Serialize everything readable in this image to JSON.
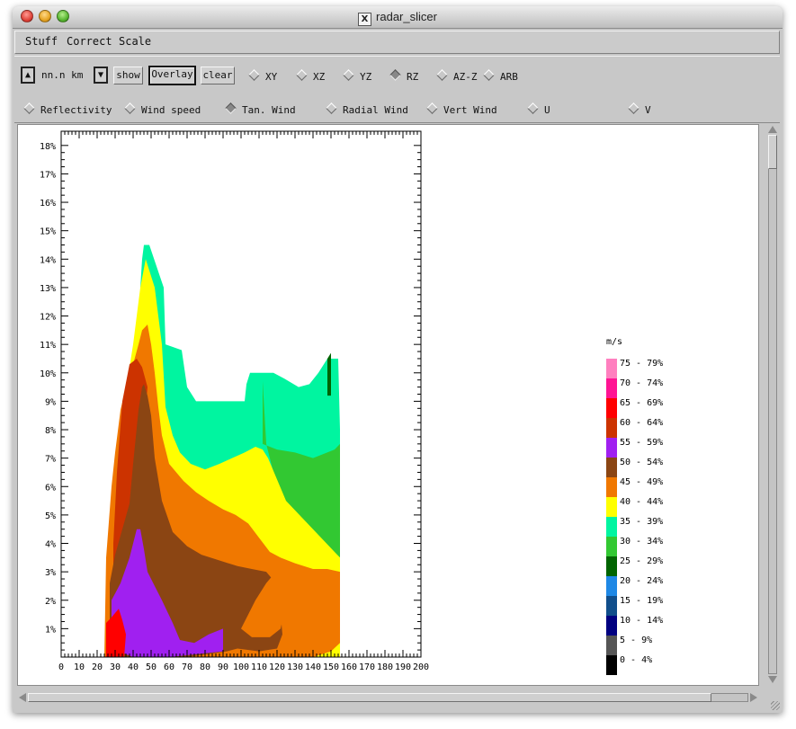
{
  "window": {
    "title": "radar_slicer"
  },
  "menubar": {
    "items": [
      "Stuff",
      "Correct",
      "Scale"
    ]
  },
  "toolbar": {
    "height_label": "nn.n km",
    "show_label": "show",
    "overlay_label": "Overlay",
    "clear_label": "clear",
    "views": [
      {
        "label": "XY",
        "selected": false
      },
      {
        "label": "XZ",
        "selected": false
      },
      {
        "label": "YZ",
        "selected": false
      },
      {
        "label": "RZ",
        "selected": true
      },
      {
        "label": "AZ-Z",
        "selected": false
      },
      {
        "label": "ARB",
        "selected": false
      }
    ],
    "fields": [
      {
        "label": "Reflectivity",
        "selected": false
      },
      {
        "label": "Wind speed",
        "selected": false
      },
      {
        "label": "Tan. Wind",
        "selected": true
      },
      {
        "label": "Radial Wind",
        "selected": false
      },
      {
        "label": "Vert Wind",
        "selected": false
      },
      {
        "label": "U",
        "selected": false
      },
      {
        "label": "V",
        "selected": false
      }
    ]
  },
  "chart_data": {
    "type": "heatmap",
    "title": "",
    "xlabel": "",
    "ylabel": "",
    "x_ticks": [
      "0",
      "10",
      "20",
      "30",
      "40",
      "50",
      "60",
      "70",
      "80",
      "90",
      "100",
      "110",
      "120",
      "130",
      "140",
      "150",
      "160",
      "170",
      "180",
      "190",
      "200"
    ],
    "y_ticks": [
      "1%",
      "2%",
      "3%",
      "4%",
      "5%",
      "6%",
      "7%",
      "8%",
      "9%",
      "10%",
      "11%",
      "12%",
      "13%",
      "14%",
      "15%",
      "16%",
      "17%",
      "18%"
    ],
    "xlim": [
      0,
      200
    ],
    "ylim": [
      0,
      18.5
    ],
    "grid": false,
    "legend": {
      "placement": "right",
      "unit": "m/s",
      "entries": [
        {
          "label": "75 - 79%",
          "color": "#ff7fbf"
        },
        {
          "label": "70 - 74%",
          "color": "#ff1493"
        },
        {
          "label": "65 - 69%",
          "color": "#ff0000"
        },
        {
          "label": "60 - 64%",
          "color": "#cc3300"
        },
        {
          "label": "55 - 59%",
          "color": "#a020f0"
        },
        {
          "label": "50 - 54%",
          "color": "#8b4513"
        },
        {
          "label": "45 - 49%",
          "color": "#f07800"
        },
        {
          "label": "40 - 44%",
          "color": "#ffff00"
        },
        {
          "label": "35 - 39%",
          "color": "#00f5a0"
        },
        {
          "label": "30 - 34%",
          "color": "#32c832"
        },
        {
          "label": "25 - 29%",
          "color": "#006400"
        },
        {
          "label": "20 - 24%",
          "color": "#1e88e5"
        },
        {
          "label": "15 - 19%",
          "color": "#104e8b"
        },
        {
          "label": "10 - 14%",
          "color": "#000080"
        },
        {
          "label": "5 - 9%",
          "color": "#555555"
        },
        {
          "label": "0 - 4%",
          "color": "#000000"
        }
      ]
    },
    "contour_bands": [
      {
        "color": "#00f5a0",
        "points": [
          [
            44,
            2
          ],
          [
            44,
            13
          ],
          [
            45,
            14
          ],
          [
            46,
            14.5
          ],
          [
            49,
            14.5
          ],
          [
            57,
            13
          ],
          [
            58,
            11
          ],
          [
            67,
            10.8
          ],
          [
            70,
            9.5
          ],
          [
            75,
            9
          ],
          [
            102,
            9
          ],
          [
            103,
            9.6
          ],
          [
            105,
            10
          ],
          [
            110,
            10
          ],
          [
            118,
            10
          ],
          [
            124,
            9.8
          ],
          [
            132,
            9.5
          ],
          [
            138,
            9.6
          ],
          [
            143,
            10
          ],
          [
            148,
            10.5
          ],
          [
            154,
            10.5
          ],
          [
            155,
            8
          ],
          [
            155,
            6
          ],
          [
            152,
            4
          ],
          [
            146,
            4.2
          ],
          [
            130,
            4.5
          ],
          [
            115,
            5
          ],
          [
            105,
            4.8
          ],
          [
            98,
            4
          ],
          [
            90,
            3.5
          ],
          [
            75,
            3.2
          ],
          [
            60,
            3
          ],
          [
            50,
            2.5
          ]
        ]
      },
      {
        "color": "#32c832",
        "points": [
          [
            112,
            9.7
          ],
          [
            112,
            7.5
          ],
          [
            120,
            7.3
          ],
          [
            130,
            7.2
          ],
          [
            140,
            7
          ],
          [
            152,
            7.3
          ],
          [
            155,
            7.5
          ],
          [
            155,
            3.5
          ],
          [
            150,
            3.8
          ],
          [
            140,
            4.5
          ],
          [
            128,
            5
          ],
          [
            120,
            6
          ],
          [
            114,
            7.5
          ]
        ]
      },
      {
        "color": "#ffff00",
        "points": [
          [
            36,
            0
          ],
          [
            33,
            5.5
          ],
          [
            33,
            8
          ],
          [
            36,
            9.5
          ],
          [
            38,
            10.2
          ],
          [
            40,
            11
          ],
          [
            44,
            13
          ],
          [
            47,
            14
          ],
          [
            52,
            13
          ],
          [
            56,
            11
          ],
          [
            58,
            8.8
          ],
          [
            62,
            7.8
          ],
          [
            66,
            7.2
          ],
          [
            72,
            6.8
          ],
          [
            80,
            6.6
          ],
          [
            88,
            6.8
          ],
          [
            95,
            7
          ],
          [
            102,
            7.2
          ],
          [
            108,
            7.4
          ],
          [
            112,
            7.3
          ],
          [
            115,
            7
          ],
          [
            125,
            5.5
          ],
          [
            140,
            4.5
          ],
          [
            155,
            3.5
          ],
          [
            155,
            0
          ]
        ]
      },
      {
        "color": "#f07800",
        "points": [
          [
            24,
            0
          ],
          [
            25,
            3.5
          ],
          [
            28,
            6
          ],
          [
            30,
            7.2
          ],
          [
            33,
            8.7
          ],
          [
            36,
            9.5
          ],
          [
            40,
            10.3
          ],
          [
            43,
            11
          ],
          [
            45,
            11.5
          ],
          [
            48,
            11.7
          ],
          [
            50,
            11
          ],
          [
            52,
            10
          ],
          [
            54,
            8.8
          ],
          [
            56,
            7.8
          ],
          [
            60,
            6.8
          ],
          [
            68,
            6.2
          ],
          [
            75,
            5.8
          ],
          [
            82,
            5.5
          ],
          [
            90,
            5.2
          ],
          [
            97,
            5
          ],
          [
            104,
            4.7
          ],
          [
            110,
            4.2
          ],
          [
            116,
            3.7
          ],
          [
            122,
            3.5
          ],
          [
            130,
            3.3
          ],
          [
            140,
            3.1
          ],
          [
            148,
            3.1
          ],
          [
            155,
            3
          ],
          [
            155,
            0.5
          ],
          [
            150,
            0.2
          ],
          [
            140,
            0
          ]
        ]
      },
      {
        "color": "#cc3300",
        "points": [
          [
            29,
            0
          ],
          [
            29,
            4
          ],
          [
            31,
            6.5
          ],
          [
            34,
            9
          ],
          [
            38,
            10.3
          ],
          [
            42,
            10.5
          ],
          [
            45,
            10.2
          ],
          [
            48,
            9.5
          ],
          [
            46,
            8
          ],
          [
            44,
            6
          ],
          [
            42,
            4
          ],
          [
            40,
            2
          ],
          [
            38,
            0
          ]
        ]
      },
      {
        "color": "#8b4513",
        "points": [
          [
            27,
            0
          ],
          [
            27,
            2.6
          ],
          [
            30,
            3.6
          ],
          [
            34,
            4.5
          ],
          [
            38,
            5.4
          ],
          [
            40,
            6.8
          ],
          [
            43,
            8.7
          ],
          [
            45,
            9.5
          ],
          [
            46,
            9.6
          ],
          [
            48,
            9.2
          ],
          [
            50,
            8.5
          ],
          [
            52,
            7
          ],
          [
            56,
            5.5
          ],
          [
            62,
            4.4
          ],
          [
            70,
            3.9
          ],
          [
            78,
            3.6
          ],
          [
            88,
            3.4
          ],
          [
            98,
            3.2
          ],
          [
            106,
            3.1
          ],
          [
            114,
            3
          ],
          [
            118,
            2.7
          ],
          [
            120,
            2.2
          ],
          [
            122,
            1.5
          ],
          [
            123,
            0.8
          ],
          [
            120,
            0.3
          ],
          [
            110,
            0.2
          ],
          [
            98,
            0.3
          ],
          [
            92,
            0.2
          ],
          [
            70,
            0
          ],
          [
            50,
            0
          ]
        ]
      },
      {
        "color": "#f07800",
        "points": [
          [
            100,
            1
          ],
          [
            104,
            1.5
          ],
          [
            108,
            2
          ],
          [
            114,
            2.6
          ],
          [
            118,
            2.9
          ],
          [
            122,
            2.3
          ],
          [
            124,
            1.6
          ],
          [
            122,
            1
          ],
          [
            116,
            0.7
          ],
          [
            106,
            0.7
          ]
        ]
      },
      {
        "color": "#a020f0",
        "points": [
          [
            28,
            0.8
          ],
          [
            28,
            2
          ],
          [
            33,
            2.6
          ],
          [
            38,
            3.5
          ],
          [
            42,
            4.5
          ],
          [
            44,
            4.5
          ],
          [
            46,
            3.8
          ],
          [
            48,
            3
          ],
          [
            52,
            2.5
          ],
          [
            56,
            2
          ],
          [
            62,
            1.2
          ],
          [
            66,
            0.6
          ],
          [
            74,
            0.5
          ],
          [
            82,
            0.8
          ],
          [
            90,
            1
          ],
          [
            90,
            0.2
          ],
          [
            60,
            0
          ],
          [
            40,
            0
          ],
          [
            32,
            0.2
          ]
        ]
      },
      {
        "color": "#ff0000",
        "points": [
          [
            25,
            0
          ],
          [
            25,
            1.2
          ],
          [
            28,
            1.4
          ],
          [
            32,
            1.7
          ],
          [
            34,
            1.3
          ],
          [
            36,
            0.8
          ],
          [
            35,
            0
          ]
        ]
      },
      {
        "color": "#006400",
        "points": [
          [
            148,
            9.2
          ],
          [
            148,
            10.5
          ],
          [
            150,
            10.7
          ],
          [
            150,
            9.2
          ]
        ]
      }
    ]
  }
}
